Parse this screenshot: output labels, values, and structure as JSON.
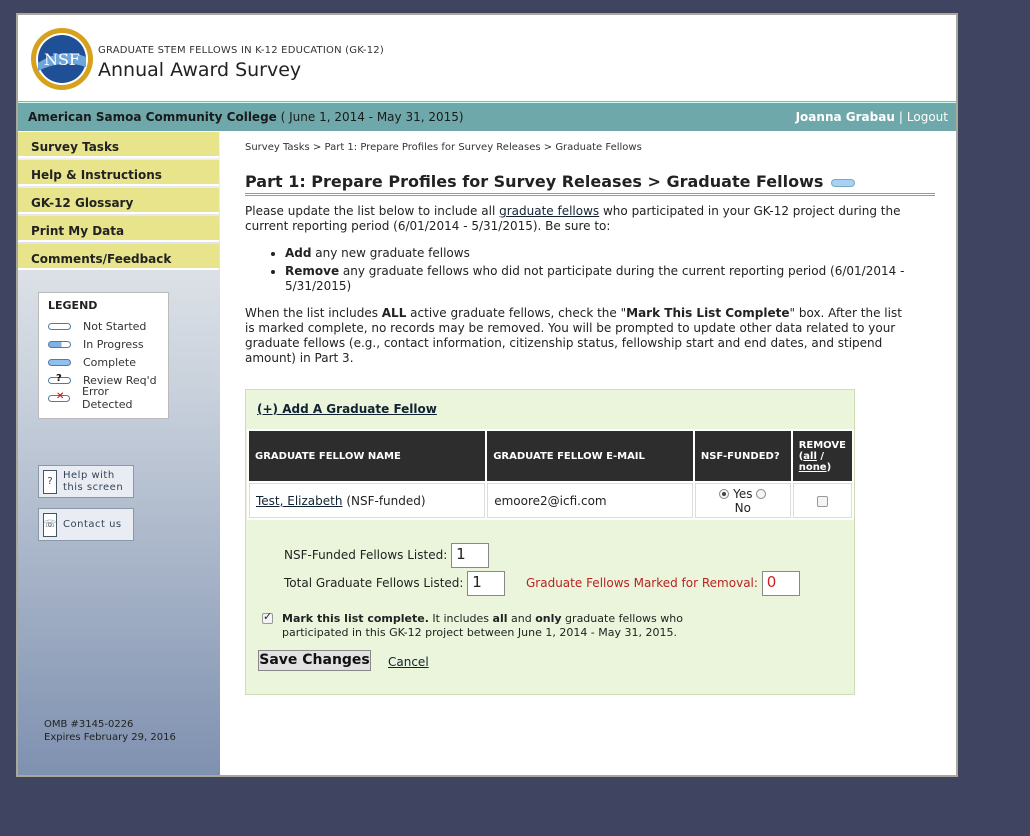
{
  "header": {
    "subtitle": "GRADUATE STEM FELLOWS IN K-12 EDUCATION (GK-12)",
    "title": "Annual Award Survey",
    "logo_text": "NSF"
  },
  "topbar": {
    "institution": "American Samoa Community College",
    "period": "( June 1, 2014 - May 31, 2015)",
    "user": "Joanna Grabau",
    "separator": "|",
    "logout": "Logout"
  },
  "sidebar": {
    "items": [
      {
        "label": "Survey Tasks"
      },
      {
        "label": "Help & Instructions"
      },
      {
        "label": "GK-12 Glossary"
      },
      {
        "label": "Print My Data"
      },
      {
        "label": "Comments/Feedback"
      }
    ],
    "legend": {
      "title": "LEGEND",
      "items": [
        {
          "label": "Not Started"
        },
        {
          "label": "In Progress"
        },
        {
          "label": "Complete"
        },
        {
          "label": "Review Req'd"
        },
        {
          "label": "Error Detected"
        }
      ]
    },
    "help_line1": "Help with",
    "help_line2": "this screen",
    "contact": "Contact us",
    "omb_line1": "OMB #3145-0226",
    "omb_line2": "Expires February 29, 2016"
  },
  "main": {
    "breadcrumb": "Survey Tasks > Part 1: Prepare Profiles for Survey Releases > Graduate Fellows",
    "heading": "Part 1: Prepare Profiles for Survey Releases > Graduate Fellows",
    "intro_a": "Please update the list below to include all ",
    "intro_link": "graduate fellows",
    "intro_b": " who participated in your GK-12 project during the current reporting period (6/01/2014 - 5/31/2015). Be sure to:",
    "bullet1_bold": "Add",
    "bullet1_text": " any new graduate fellows",
    "bullet2_bold": "Remove",
    "bullet2_text": " any graduate fellows who did not participate during the current reporting period (6/01/2014 - 5/31/2015)",
    "complete_a": "When the list includes ",
    "complete_bold": "ALL",
    "complete_b": " active graduate fellows, check the \"",
    "complete_bold2": "Mark This List Complete",
    "complete_c": "\" box. After the list is marked complete, no records may be removed. You will be prompted to update other data related to your graduate fellows (e.g., contact information, citizenship status, fellowship start and end dates, and stipend amount) in Part 3.",
    "add_link": "(+) Add A Graduate Fellow",
    "table": {
      "headers": [
        "GRADUATE FELLOW NAME",
        "GRADUATE FELLOW E-MAIL",
        "NSF-FUNDED?"
      ],
      "remove_header": "REMOVE",
      "remove_all": "all",
      "remove_sep": " / ",
      "remove_none": "none",
      "rows": [
        {
          "name": "Test, Elizabeth",
          "note": "(NSF-funded)",
          "email": "emoore2@icfi.com",
          "yes": "Yes",
          "no": "No",
          "funded": "Yes"
        }
      ]
    },
    "nsf_label": "NSF-Funded Fellows Listed:",
    "nsf_value": "1",
    "total_label": "Total Graduate Fellows Listed:",
    "total_value": "1",
    "removal_label": "Graduate Fellows Marked for Removal:",
    "removal_value": "0",
    "mark_bold": "Mark this list complete.",
    "mark_a": " It includes ",
    "mark_all": "all",
    "mark_b": " and ",
    "mark_only": "only",
    "mark_c": " graduate fellows who participated in this GK-12 project between June 1, 2014 - May 31, 2015.",
    "save": "Save Changes",
    "cancel": "Cancel"
  }
}
